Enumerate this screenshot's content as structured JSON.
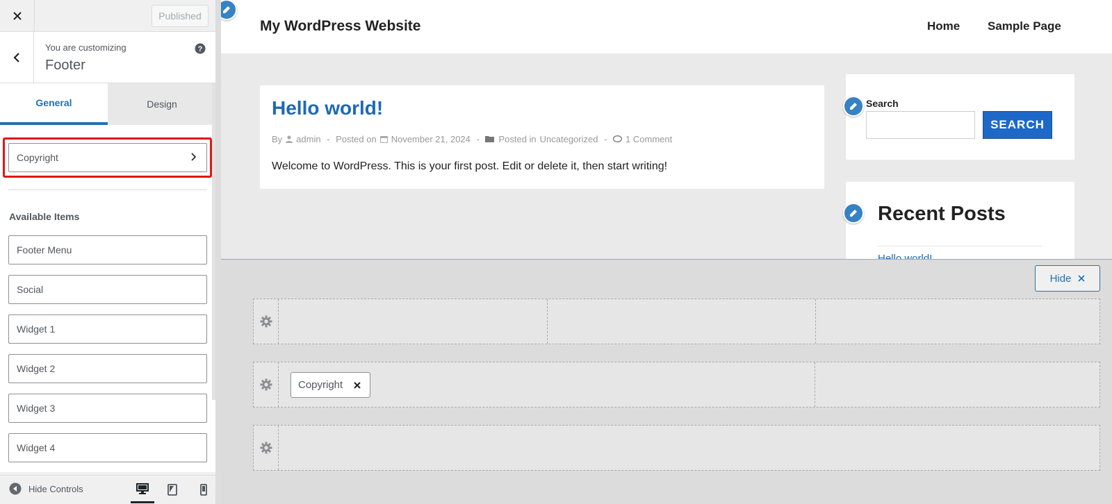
{
  "panel": {
    "publish_label": "Published",
    "customizing_label": "You are customizing",
    "section_title": "Footer",
    "tabs": [
      {
        "label": "General"
      },
      {
        "label": "Design"
      }
    ],
    "copyright_control": "Copyright",
    "available_title": "Available Items",
    "items": [
      "Footer Menu",
      "Social",
      "Widget 1",
      "Widget 2",
      "Widget 3",
      "Widget 4"
    ],
    "hide_controls": "Hide Controls"
  },
  "site": {
    "title": "My WordPress Website",
    "nav": [
      "Home",
      "Sample Page"
    ],
    "post": {
      "title": "Hello world!",
      "by": "By",
      "author": "admin",
      "posted_on": "Posted on",
      "date": "November 21, 2024",
      "posted_in": "Posted in",
      "category": "Uncategorized",
      "comments": "1 Comment",
      "body": "Welcome to WordPress. This is your first post. Edit or delete it, then start writing!"
    },
    "search_label": "Search",
    "search_button": "SEARCH",
    "recent_title": "Recent Posts",
    "recent_link": "Hello world!"
  },
  "builder": {
    "hide_label": "Hide",
    "chip_label": "Copyright"
  },
  "colors": {
    "accent": "#2271b1",
    "highlight": "#e01717",
    "link": "#1e69b7"
  }
}
